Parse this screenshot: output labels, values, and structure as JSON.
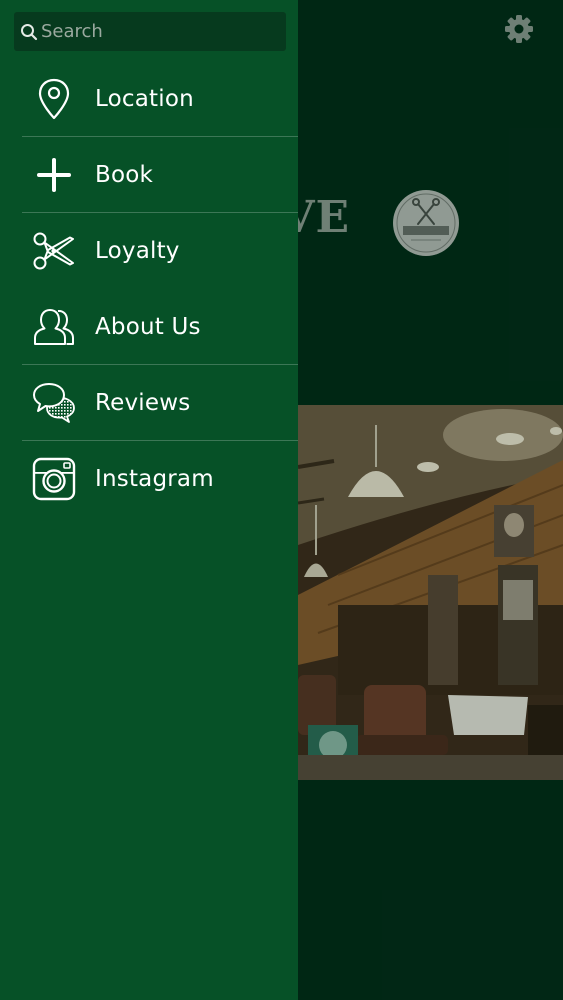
{
  "search": {
    "placeholder": "Search",
    "value": ""
  },
  "menu": {
    "items": [
      {
        "id": "location",
        "label": "Location",
        "icon": "map-pin-icon"
      },
      {
        "id": "book",
        "label": "Book",
        "icon": "plus-icon"
      },
      {
        "id": "loyalty",
        "label": "Loyalty",
        "icon": "scissors-icon"
      },
      {
        "id": "about-us",
        "label": "About Us",
        "icon": "people-icon"
      },
      {
        "id": "reviews",
        "label": "Reviews",
        "icon": "chat-bubbles-icon"
      },
      {
        "id": "instagram",
        "label": "Instagram",
        "icon": "instagram-icon"
      }
    ]
  },
  "background": {
    "brand_text": "VE",
    "settings_icon": "gear-icon",
    "logo_icon": "barber-logo-icon"
  },
  "colors": {
    "drawer": "#065127",
    "search_field": "#063a1e",
    "background_screen": "#012a17",
    "text": "#ffffff"
  }
}
